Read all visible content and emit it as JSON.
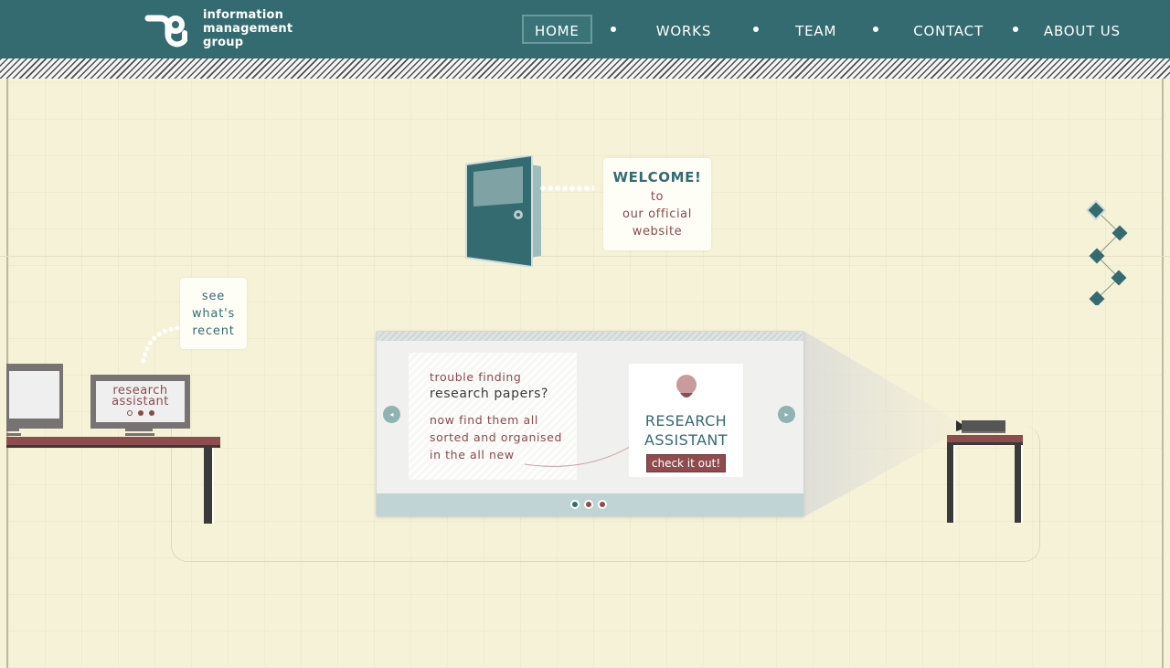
{
  "logo": {
    "lines": [
      "information",
      "management",
      "group"
    ]
  },
  "nav": {
    "items": [
      {
        "label": "HOME",
        "active": true
      },
      {
        "label": "WORKS",
        "active": false
      },
      {
        "label": "TEAM",
        "active": false
      },
      {
        "label": "CONTACT",
        "active": false
      },
      {
        "label": "ABOUT US",
        "active": false
      }
    ]
  },
  "welcome": {
    "title": "WELCOME!",
    "line1": "to",
    "line2": "our official",
    "line3": "website"
  },
  "recent": {
    "line1": "see",
    "line2": "what's",
    "line3": "recent"
  },
  "monitor": {
    "line1": "research",
    "line2": "assistant"
  },
  "slider": {
    "line1": "trouble finding",
    "line2": "research papers?",
    "line3": "now find them all",
    "line4": "sorted and organised",
    "line5": "in the all new",
    "card_title1": "RESEARCH",
    "card_title2": "ASSISTANT",
    "button": "check it out!",
    "prev_icon": "◂",
    "next_icon": "▸",
    "dot_colors": [
      "#346b70",
      "#8f4c4f",
      "#8f4c4f"
    ]
  },
  "colors": {
    "teal": "#346b70",
    "maroon": "#8f4c4f",
    "cream": "#f6f2d8"
  }
}
